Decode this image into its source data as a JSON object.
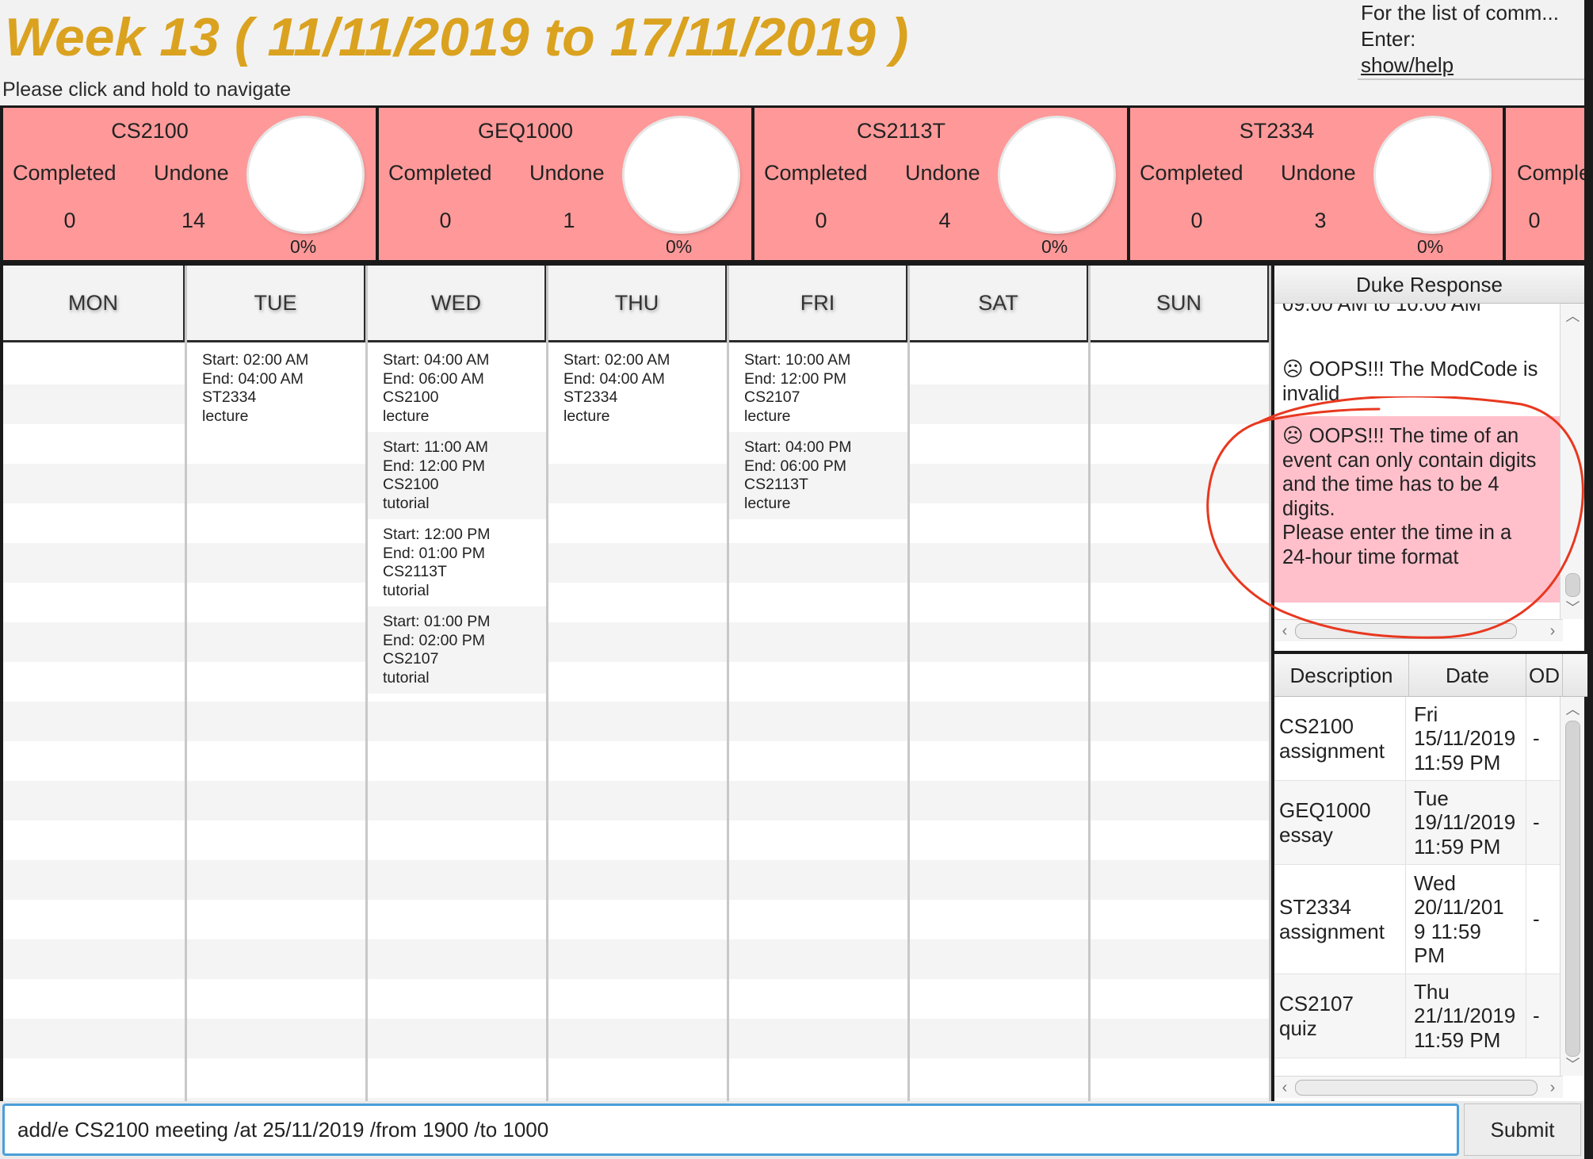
{
  "header": {
    "week_title": "Week 13 ( 11/11/2019 to 17/11/2019 )",
    "nav_hint": "Please click and hold to navigate",
    "help_lines": [
      "For the list of comm...",
      "Enter:"
    ],
    "help_link": "show/help"
  },
  "modules": [
    {
      "code": "CS2100",
      "completed_label": "Completed",
      "undone_label": "Undone",
      "completed": "0",
      "undone": "14",
      "percent": "0%"
    },
    {
      "code": "GEQ1000",
      "completed_label": "Completed",
      "undone_label": "Undone",
      "completed": "0",
      "undone": "1",
      "percent": "0%"
    },
    {
      "code": "CS2113T",
      "completed_label": "Completed",
      "undone_label": "Undone",
      "completed": "0",
      "undone": "4",
      "percent": "0%"
    },
    {
      "code": "ST2334",
      "completed_label": "Completed",
      "undone_label": "Undone",
      "completed": "0",
      "undone": "3",
      "percent": "0%"
    },
    {
      "code": "",
      "completed_label": "Comple",
      "undone_label": "",
      "completed": "0",
      "undone": "",
      "percent": ""
    }
  ],
  "days": [
    {
      "name": "MON",
      "events": []
    },
    {
      "name": "TUE",
      "events": [
        {
          "start": "Start: 02:00 AM",
          "end": "End: 04:00 AM",
          "module": "ST2334",
          "type": "lecture"
        }
      ]
    },
    {
      "name": "WED",
      "events": [
        {
          "start": "Start: 04:00 AM",
          "end": "End: 06:00 AM",
          "module": "CS2100",
          "type": "lecture"
        },
        {
          "start": "Start: 11:00 AM",
          "end": "End: 12:00 PM",
          "module": "CS2100",
          "type": "tutorial"
        },
        {
          "start": "Start: 12:00 PM",
          "end": "End: 01:00 PM",
          "module": "CS2113T",
          "type": "tutorial"
        },
        {
          "start": "Start: 01:00 PM",
          "end": "End: 02:00 PM",
          "module": "CS2107",
          "type": "tutorial"
        }
      ]
    },
    {
      "name": "THU",
      "events": [
        {
          "start": "Start: 02:00 AM",
          "end": "End: 04:00 AM",
          "module": "ST2334",
          "type": "lecture"
        }
      ]
    },
    {
      "name": "FRI",
      "events": [
        {
          "start": "Start: 10:00 AM",
          "end": "End: 12:00 PM",
          "module": "CS2107",
          "type": "lecture"
        },
        {
          "start": "Start: 04:00 PM",
          "end": "End: 06:00 PM",
          "module": "CS2113T",
          "type": "lecture"
        }
      ]
    },
    {
      "name": "SAT",
      "events": []
    },
    {
      "name": "SUN",
      "events": []
    }
  ],
  "response": {
    "title": "Duke Response",
    "partial_line": "09:00 AM to 10:00 AM",
    "invalid_lines": [
      "☹ OOPS!!! The ModCode is",
      "invalid"
    ],
    "time_error_lines": [
      "☹ OOPS!!! The time of an",
      "event can only contain digits",
      "and the time has to be 4",
      "digits.",
      "Please enter the time in a",
      "24-hour time format"
    ],
    "highlight_color": "#ffc0cb",
    "annotation_color": "#e8381f"
  },
  "deadlines": {
    "headers": {
      "description": "Description",
      "date": "Date",
      "od": "OD"
    },
    "rows": [
      {
        "desc": [
          "CS2100",
          "assignment"
        ],
        "date": [
          "Fri",
          "15/11/2019",
          "11:59 PM"
        ],
        "od": "-"
      },
      {
        "desc": [
          "GEQ1000",
          "essay"
        ],
        "date": [
          "Tue",
          "19/11/2019",
          "11:59 PM"
        ],
        "od": "-"
      },
      {
        "desc": [
          "ST2334",
          "assignment"
        ],
        "date": [
          "Wed",
          "20/11/201",
          "9 11:59",
          "PM"
        ],
        "od": "-"
      },
      {
        "desc": [
          "CS2107",
          "quiz"
        ],
        "date": [
          "Thu",
          "21/11/2019",
          "11:59 PM"
        ],
        "od": "-"
      }
    ]
  },
  "command": {
    "value": "add/e CS2100 meeting /at 25/11/2019 /from 1900 /to 1000",
    "submit_label": "Submit"
  },
  "colors": {
    "title": "#daa21f",
    "module_card": "#ff9999",
    "input_focus": "#4a9fd8"
  },
  "icons": {
    "scroll_up": "chevron-up-icon",
    "scroll_down": "chevron-down-icon",
    "scroll_left": "chevron-left-icon",
    "scroll_right": "chevron-right-icon"
  }
}
